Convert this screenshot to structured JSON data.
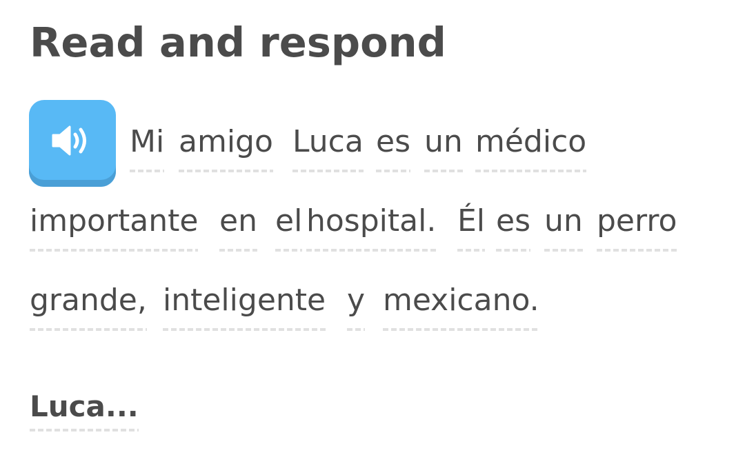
{
  "header": {
    "title": "Read and respond"
  },
  "audio": {
    "icon": "speaker-icon",
    "button_color": "#58b9f5"
  },
  "passage": {
    "lines": [
      [
        "Mi",
        "amigo",
        "Luca",
        "es",
        "un",
        "médico"
      ],
      [
        "importante",
        "en",
        "el",
        "hospital.",
        "Él",
        "es",
        "un",
        "perro"
      ],
      [
        "grande,",
        "inteligente",
        "y",
        "mexicano."
      ]
    ]
  },
  "question": {
    "prompt": "Luca..."
  }
}
